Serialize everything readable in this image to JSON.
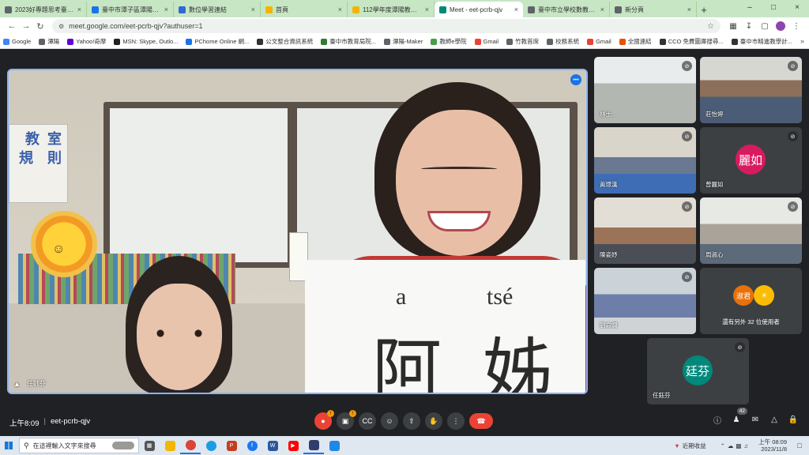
{
  "browser": {
    "tabs": [
      {
        "label": "2023好專題思考臺灣都市計",
        "icon_color": "#5f6368",
        "active": false
      },
      {
        "label": "臺中市潭子區潭陽國民小",
        "icon_color": "#1a73e8",
        "active": false
      },
      {
        "label": "數位學習連結",
        "icon_color": "#3367d6",
        "active": false
      },
      {
        "label": "首頁",
        "icon_color": "#f4b400",
        "active": false
      },
      {
        "label": "112學年度潭陽教師聯絡",
        "icon_color": "#f4b400",
        "active": false
      },
      {
        "label": "Meet - eet-pcrb-qjv",
        "icon_color": "#00897b",
        "active": true
      },
      {
        "label": "臺中市立學校數教育協",
        "icon_color": "#5f6368",
        "active": false
      },
      {
        "label": "新分頁",
        "icon_color": "#5f6368",
        "active": false
      }
    ],
    "url": "meet.google.com/eet-pcrb-qjv?authuser=1",
    "bookmarks": [
      {
        "label": "Google",
        "color": "#4285f4"
      },
      {
        "label": "潭陽",
        "color": "#5f6368"
      },
      {
        "label": "Yahoo!奇摩",
        "color": "#6001d2"
      },
      {
        "label": "MSN: Skype, Outlo...",
        "color": "#222222"
      },
      {
        "label": "PChome Online 網...",
        "color": "#1a73e8"
      },
      {
        "label": "公文整合資訊系統",
        "color": "#333333"
      },
      {
        "label": "臺中市教育局院...",
        "color": "#2e7d32"
      },
      {
        "label": "潭陽-Maker",
        "color": "#5f6368"
      },
      {
        "label": "教師e學院",
        "color": "#43a047"
      },
      {
        "label": "Gmail",
        "color": "#ea4335"
      },
      {
        "label": "竹教首席",
        "color": "#5f6368"
      },
      {
        "label": "校務系統",
        "color": "#5f6368"
      },
      {
        "label": "Gmail",
        "color": "#ea4335"
      },
      {
        "label": "全國連結",
        "color": "#e65100"
      },
      {
        "label": "CCO 免費圖庫搜尋...",
        "color": "#333333"
      },
      {
        "label": "臺中市精進教學計...",
        "color": "#333333"
      }
    ]
  },
  "main_video": {
    "speaker_name": "任鈺芬",
    "card_pinyin": [
      "a",
      "tsé"
    ],
    "card_hanzi": [
      "阿",
      "姊"
    ],
    "poster_chars": [
      "教",
      "室",
      "規",
      "則"
    ]
  },
  "participants": [
    {
      "name": "林士...",
      "type": "video",
      "muted": true
    },
    {
      "name": "莊怡婷",
      "type": "video",
      "muted": true
    },
    {
      "name": "黃璟漢",
      "type": "video",
      "muted": true
    },
    {
      "name": "曾麗如",
      "type": "avatar",
      "initials": "麗如",
      "color": "#d81b60",
      "muted": true
    },
    {
      "name": "陳姿妤",
      "type": "video",
      "muted": true
    },
    {
      "name": "周淑心",
      "type": "video",
      "muted": true
    },
    {
      "name": "劉俞嫺",
      "type": "video",
      "muted": true
    },
    {
      "name": "還有另外 32 位使用者",
      "type": "others",
      "avatars": [
        {
          "initials": "淑君",
          "color": "#e8710a"
        },
        {
          "initials": "☀",
          "color": "#fbbc04"
        }
      ]
    },
    {
      "name": "任鈺芬",
      "type": "avatar",
      "initials": "廷芬",
      "color": "#00897b",
      "muted": true
    }
  ],
  "meeting": {
    "time": "上午8:09",
    "code": "eet-pcrb-qjv",
    "participant_count": "42"
  },
  "taskbar": {
    "search_placeholder": "在這裡輸入文字來搜尋",
    "weather": "近期收益",
    "clock_time": "上午 08:09",
    "clock_date": "2023/11/8"
  }
}
